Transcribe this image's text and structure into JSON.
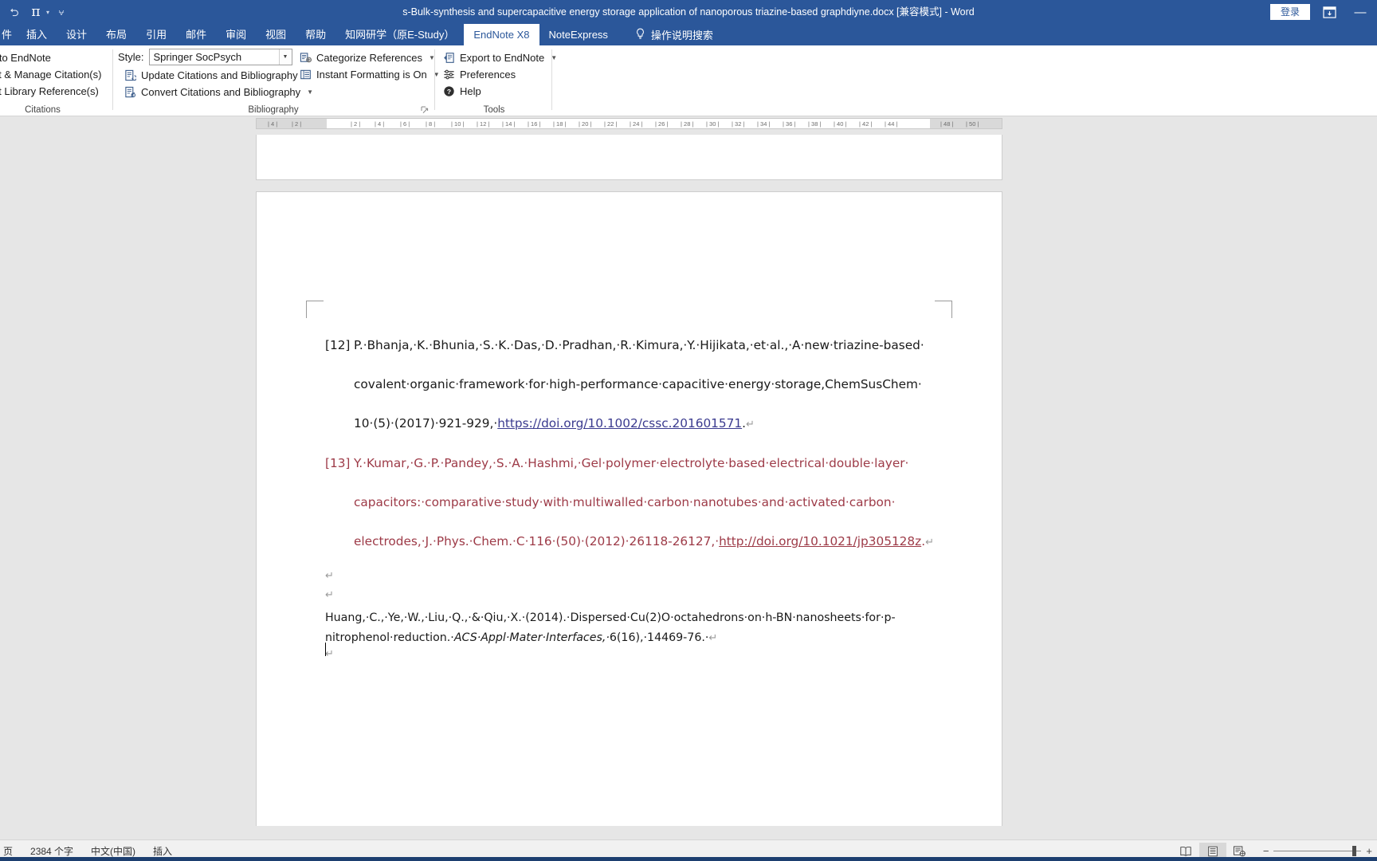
{
  "titlebar": {
    "document_title": "s-Bulk-synthesis and supercapacitive energy storage application of nanoporous triazine-based graphdiyne.docx [兼容模式]  -  Word",
    "quick_access": [
      {
        "name": "undo-icon",
        "glyph": "↺"
      },
      {
        "name": "formula-pi-icon",
        "glyph": "π"
      },
      {
        "name": "customize-qat-icon",
        "glyph": "⌄"
      }
    ],
    "sign_in_label": "登录",
    "ribbon_display_options_icon": "ribbon-display-options-icon",
    "minimize_label": "—"
  },
  "tabs": [
    {
      "label": "件",
      "active": false
    },
    {
      "label": "插入",
      "active": false
    },
    {
      "label": "设计",
      "active": false
    },
    {
      "label": "布局",
      "active": false
    },
    {
      "label": "引用",
      "active": false
    },
    {
      "label": "邮件",
      "active": false
    },
    {
      "label": "审阅",
      "active": false
    },
    {
      "label": "视图",
      "active": false
    },
    {
      "label": "帮助",
      "active": false
    },
    {
      "label": "知网研学（原E-Study）",
      "active": false
    },
    {
      "label": "EndNote X8",
      "active": true
    },
    {
      "label": "NoteExpress",
      "active": false
    }
  ],
  "tell_me": {
    "label": "操作说明搜索",
    "icon": "lightbulb-icon"
  },
  "ribbon": {
    "groups": [
      {
        "name": "citations",
        "label": "Citations",
        "items": [
          {
            "label": "o to EndNote",
            "icon": "go-to-endnote-icon",
            "dropdown": false
          },
          {
            "label": "dit & Manage Citation(s)",
            "icon": "edit-citations-icon",
            "dropdown": false
          },
          {
            "label": "dit Library Reference(s)",
            "icon": "edit-library-icon",
            "dropdown": false
          }
        ]
      },
      {
        "name": "bibliography",
        "label": "Bibliography",
        "style_label": "Style:",
        "style_value": "Springer SocPsych",
        "items": [
          {
            "label": "Update Citations and Bibliography",
            "icon": "update-bibliography-icon",
            "dropdown": false
          },
          {
            "label": "Convert Citations and Bibliography",
            "icon": "convert-bibliography-icon",
            "dropdown": true
          },
          {
            "label": "Categorize References",
            "icon": "categorize-references-icon",
            "dropdown": true
          },
          {
            "label": "Instant Formatting is On",
            "icon": "instant-formatting-icon",
            "dropdown": true
          }
        ]
      },
      {
        "name": "tools",
        "label": "Tools",
        "items": [
          {
            "label": "Export to EndNote",
            "icon": "export-to-endnote-icon",
            "dropdown": true
          },
          {
            "label": "Preferences",
            "icon": "preferences-icon",
            "dropdown": false
          },
          {
            "label": "Help",
            "icon": "help-icon",
            "dropdown": false
          }
        ]
      }
    ]
  },
  "ruler": {
    "ticks": [
      "4",
      "2",
      "2",
      "4",
      "6",
      "8",
      "10",
      "12",
      "14",
      "16",
      "18",
      "20",
      "22",
      "24",
      "26",
      "28",
      "30",
      "32",
      "34",
      "36",
      "38",
      "40",
      "42",
      "44",
      "48",
      "50"
    ]
  },
  "document": {
    "references": [
      {
        "number": "[12]",
        "color": "#1a1a1a",
        "lines": [
          [
            {
              "t": "P.·Bhanja,·K.·Bhunia,·S.·K.·Das,·D.·Pradhan,·R.·Kimura,·Y.·Hijikata,·et·al.,·A·new·triazine-based·",
              "link": false
            }
          ],
          [
            {
              "t": "covalent·organic·framework·for·high-performance·capacitive·energy·storage,ChemSusChem·",
              "link": false
            }
          ],
          [
            {
              "t": "10·(5)·(2017)·921-929,·",
              "link": false
            },
            {
              "t": "https://doi.org/10.1002/cssc.201601571",
              "link": true
            },
            {
              "t": ".",
              "link": false
            },
            {
              "t": "↵",
              "mark": true
            }
          ]
        ]
      },
      {
        "number": "[13]",
        "color": "#9d3a47",
        "lines": [
          [
            {
              "t": "Y.·Kumar,·G.·P.·Pandey,·S.·A.·Hashmi,·Gel·polymer·electrolyte·based·electrical·double·layer·",
              "link": false
            }
          ],
          [
            {
              "t": "capacitors:·comparative·study·with·multiwalled·carbon·nanotubes·and·activated·carbon·",
              "link": false
            }
          ],
          [
            {
              "t": "electrodes,·J.·Phys.·Chem.·C·116·(50)·(2012)·26118-26127,·",
              "link": false
            },
            {
              "t": "http://doi.org/10.1021/jp305128z",
              "link": true
            },
            {
              "t": ".",
              "link": false
            },
            {
              "t": "↵",
              "mark": true
            }
          ]
        ]
      }
    ],
    "blank_paragraph_marks": [
      "↵",
      "↵"
    ],
    "plain_paragraph": {
      "line1_pre": "Huang,·C.,·Ye,·W.,·Liu,·Q.,·&·Qiu,·X.·(2014).·Dispersed·Cu(2)O·octahedrons·on·h-BN·nanosheets·for·p-nitrophenol·",
      "line2_pre": "reduction.·",
      "line2_italic": "ACS·Appl·Mater·Interfaces,·",
      "line2_post": "6(16),·14469-76.·",
      "line2_mark": "↵"
    },
    "trailing_mark": "↵"
  },
  "statusbar": {
    "page_label": "页",
    "word_count": "2384 个字",
    "language": "中文(中国)",
    "insert_mode": "插入",
    "view_buttons": [
      {
        "name": "read-mode-icon",
        "active": false
      },
      {
        "name": "print-layout-icon",
        "active": true
      },
      {
        "name": "web-layout-icon",
        "active": false
      }
    ],
    "zoom_minus": "−",
    "zoom_plus": "+"
  },
  "colors": {
    "word_blue": "#2b579a",
    "ref13_red": "#9d3a47",
    "hyperlink_blue": "#3b3b8f",
    "canvas_gray": "#e6e6e6"
  }
}
